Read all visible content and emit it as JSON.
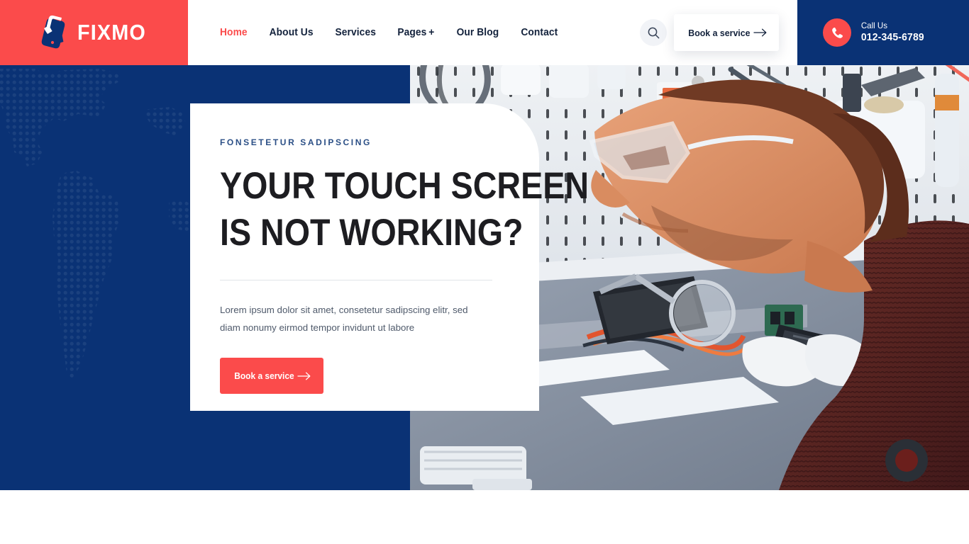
{
  "brand": {
    "name": "FIXMO",
    "logo_icon": "phone-repair-arrows-icon",
    "red": "#FB4B4B",
    "navy": "#0A3275"
  },
  "header": {
    "nav": [
      {
        "label": "Home",
        "active": true,
        "has_caret": false
      },
      {
        "label": "About Us",
        "active": false,
        "has_caret": false
      },
      {
        "label": "Services",
        "active": false,
        "has_caret": false
      },
      {
        "label": "Pages",
        "active": false,
        "has_caret": true,
        "caret": "+"
      },
      {
        "label": "Our Blog",
        "active": false,
        "has_caret": false
      },
      {
        "label": "Contact",
        "active": false,
        "has_caret": false
      }
    ],
    "search_icon": "search-icon",
    "book_button": {
      "label": "Book a service",
      "icon": "arrow-right-icon"
    },
    "call": {
      "icon": "phone-icon",
      "label": "Call Us",
      "number": "012-345-6789"
    }
  },
  "hero": {
    "eyebrow": "FONSETETUR SADIPSCING",
    "title_line1": "YOUR TOUCH SCREEN",
    "title_line2": "IS NOT WORKING?",
    "paragraph": "Lorem ipsum dolor sit amet, consetetur sadipscing elitr, sed diam nonumy eirmod tempor invidunt ut labore",
    "cta": {
      "label": "Book a service",
      "icon": "arrow-right-icon"
    },
    "background_pattern": "dotted-world-map",
    "photo_alt": "technician-repairing-phone-at-workbench"
  }
}
